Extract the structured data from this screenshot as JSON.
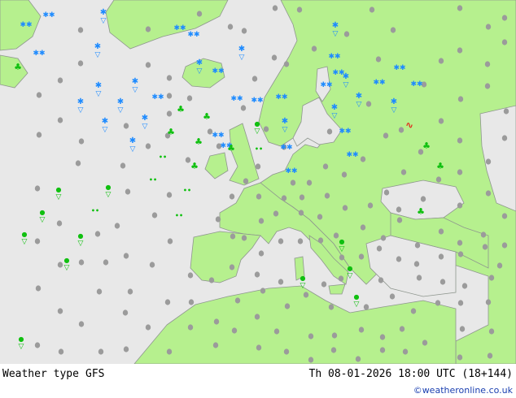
{
  "footer": {
    "title": "Weather type",
    "model": "GFS",
    "valid_time": "Th 08-01-2026 18:00 UTC (18+144)",
    "credit": "©weatheronline.co.uk"
  },
  "colors": {
    "sea": "#e8e8e8",
    "land": "#b6f08e",
    "border": "#9aa09a",
    "dot": "#9b9b9b",
    "snow": "#1e8bff",
    "rain": "#10c010",
    "mixed": "#e03020"
  },
  "icons": {
    "dot": "grey-dot (dry/cloud)",
    "snow": "snowflake-icon",
    "snow-shower": "snow-shower-icon",
    "rain-shower": "rain-shower-icon",
    "rain": "rain-icon",
    "drizzle": "drizzle-icon",
    "thunder": "thunderstorm-icon"
  }
}
